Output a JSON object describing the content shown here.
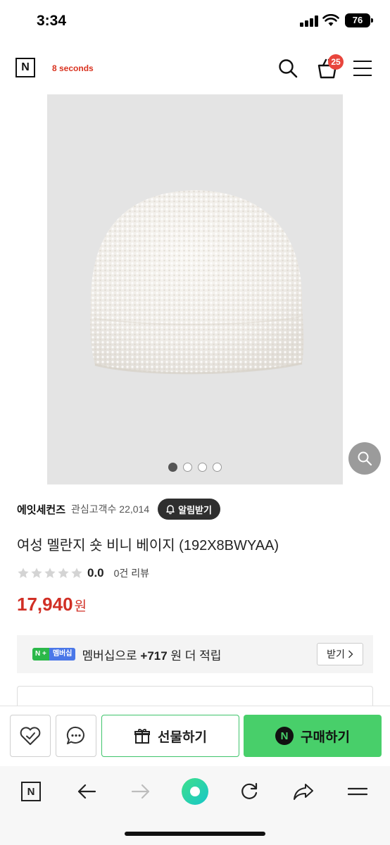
{
  "status_bar": {
    "time": "3:34",
    "battery": "76"
  },
  "header": {
    "logo_letter": "N",
    "brand_name": "8 seconds",
    "cart_count": "25",
    "icons": [
      "search-icon",
      "cart-icon",
      "menu-icon"
    ]
  },
  "gallery": {
    "image_count": 4,
    "active_index": 0
  },
  "shop": {
    "name": "에잇세컨즈",
    "fav_count": "관심고객수 22,014",
    "alert_label": "알림받기"
  },
  "product": {
    "title": "여성 멜란지 숏 비니 베이지 (192X8BWYAA)",
    "rating": "0.0",
    "star_count": 5,
    "stars_filled": 0,
    "review_count": "0건 리뷰",
    "price": "17,940",
    "price_unit": "원"
  },
  "membership": {
    "badge_plus": "N +",
    "badge_label": "멤버십",
    "text_prefix": "멤버십으로",
    "points": "+717",
    "text_suffix": "원 더 적립",
    "receive_label": "받기"
  },
  "actions": {
    "gift_label": "선물하기",
    "buy_label": "구매하기",
    "buy_icon_letter": "N"
  },
  "browser": {
    "logo_letter": "N"
  },
  "colors": {
    "brand_red": "#d12f25",
    "naver_green": "#48cf6a",
    "badge_red": "#e8453c"
  }
}
